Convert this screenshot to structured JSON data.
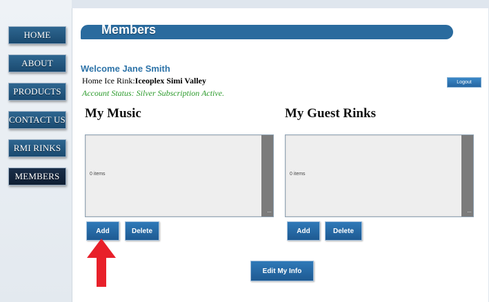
{
  "nav": {
    "items": [
      {
        "label": "HOME"
      },
      {
        "label": "ABOUT"
      },
      {
        "label": "PRODUCTS"
      },
      {
        "label": "CONTACT US"
      },
      {
        "label": "RMI RINKS"
      },
      {
        "label": "MEMBERS"
      }
    ],
    "active": "MEMBERS"
  },
  "header": {
    "title": "Members"
  },
  "user": {
    "welcome": "Welcome Jane Smith",
    "rink_label": "Home Ice Rink:",
    "rink_value": "Iceoplex Simi Valley",
    "account_status": "Account Status: Silver Subscription Active."
  },
  "logout_label": "Logout",
  "music": {
    "title": "My Music",
    "count": "0 items",
    "add_label": "Add",
    "delete_label": "Delete"
  },
  "guest_rinks": {
    "title": "My Guest Rinks",
    "count": "0 items",
    "add_label": "Add",
    "delete_label": "Delete"
  },
  "edit_info_label": "Edit My Info",
  "colors": {
    "accent": "#2a6b9e",
    "status_green": "#2a9a2a",
    "annotation_arrow": "#e8202a"
  },
  "icons": {
    "pointer": "arrow-up-icon"
  }
}
